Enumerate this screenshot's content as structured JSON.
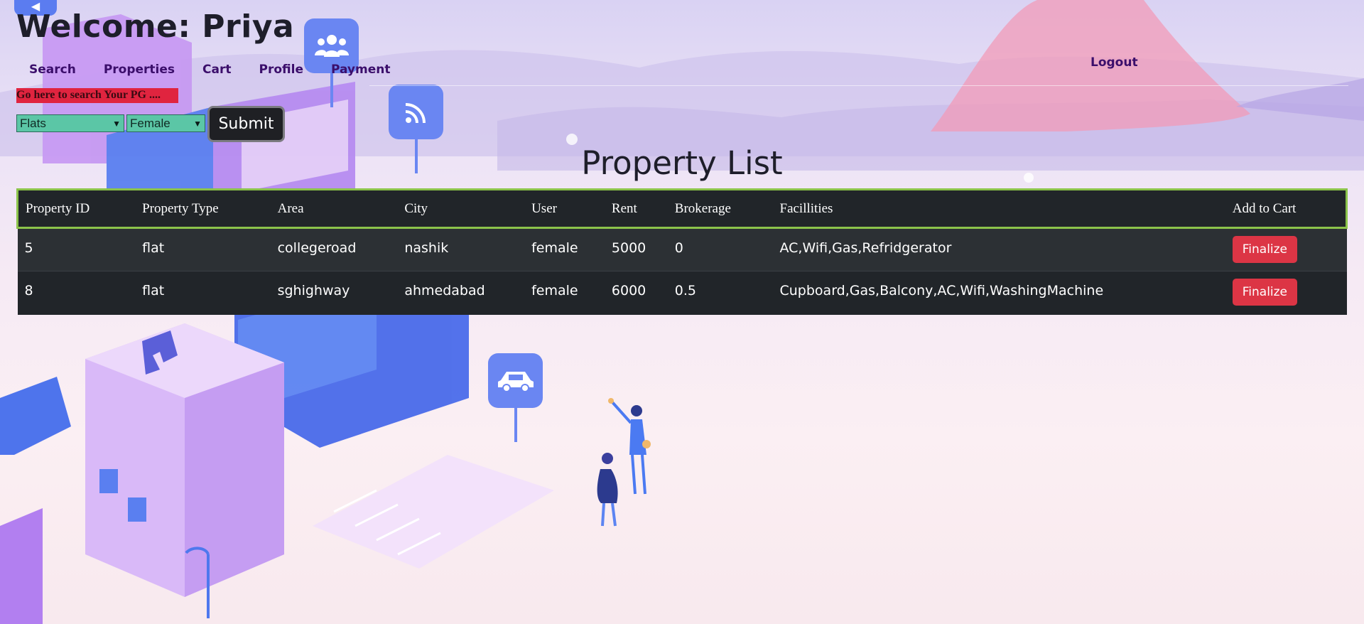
{
  "header": {
    "welcome": "Welcome: Priya",
    "nav": [
      "Search",
      "Properties",
      "Cart",
      "Profile",
      "Payment"
    ],
    "logout": "Logout"
  },
  "search": {
    "hint": "Go here to search Your PG ....",
    "type_select": "Flats",
    "gender_select": "Female",
    "submit_label": "Submit"
  },
  "page_title": "Property List",
  "table": {
    "headers": [
      "Property ID",
      "Property Type",
      "Area",
      "City",
      "User",
      "Rent",
      "Brokerage",
      "Facillities",
      "Add to Cart"
    ],
    "rows": [
      [
        "5",
        "flat",
        "collegeroad",
        "nashik",
        "female",
        "5000",
        "0",
        "AC,Wifi,Gas,Refridgerator",
        "Finalize"
      ],
      [
        "8",
        "flat",
        "sghighway",
        "ahmedabad",
        "female",
        "6000",
        "0.5",
        "Cupboard,Gas,Balcony,AC,Wifi,WashingMachine",
        "Finalize"
      ]
    ]
  },
  "colors": {
    "table_bg": "#212529",
    "table_header_border": "#8bc34a",
    "finalize_button": "#dc3545",
    "select_bg": "#5bc6a6",
    "hint_bg": "#e0243f",
    "nav_text": "#3b0e6b"
  },
  "icons": [
    "users-icon",
    "wifi-icon",
    "car-icon",
    "hotel-h-icon"
  ]
}
